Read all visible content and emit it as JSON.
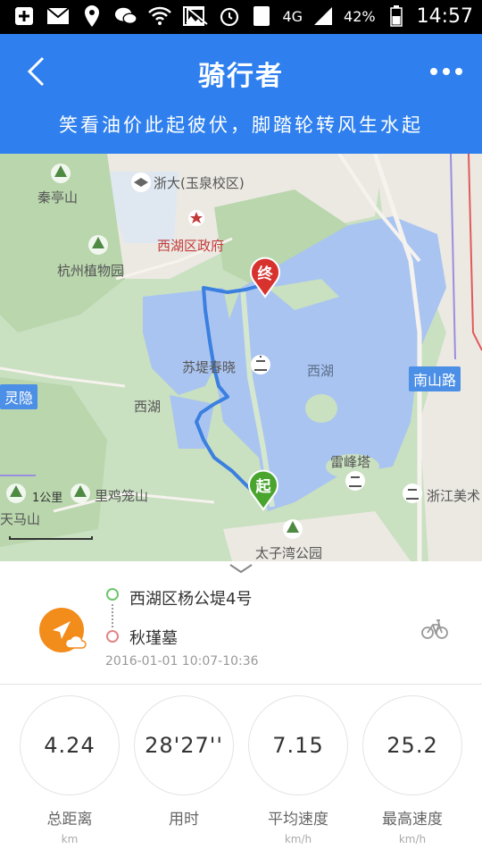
{
  "status_bar": {
    "signal": "4G",
    "sim": "1",
    "battery": "42%",
    "time": "14:57",
    "icons": [
      "add-icon",
      "mail-icon",
      "location-icon",
      "wechat-icon",
      "wifi-icon",
      "image-icon",
      "mute-icon",
      "alarm-icon",
      "sim-icon",
      "signal-icon",
      "battery-icon"
    ]
  },
  "header": {
    "title": "骑行者",
    "slogan": "笑看油价此起彼伏，脚踏轮转风生水起",
    "accent": "#2f80ee"
  },
  "map": {
    "labels": {
      "qinting_shan": "秦亭山",
      "zheda": "浙大(玉泉校区)",
      "district_gov": "西湖区政府",
      "botanical": "杭州植物园",
      "su_causeway": "苏堤春晓",
      "west_lake": "西湖",
      "xihu_small": "西湖",
      "lingyin": "灵隐",
      "leifeng": "雷峰塔",
      "jiliu": "里鸡笼山",
      "tianma": "天马山",
      "zhejiang_museum": "浙江美术",
      "taiziwan": "太子湾公园",
      "nanshan_road": "南山路"
    },
    "markers": {
      "end": "终",
      "start": "起"
    },
    "scale": "1公里",
    "route_color": "#3b7fe0"
  },
  "trip": {
    "start_place": "西湖区杨公堤4号",
    "end_place": "秋瑾墓",
    "time_range": "2016-01-01 10:07-10:36"
  },
  "stats": [
    {
      "value": "4.24",
      "label": "总距离",
      "unit": "km"
    },
    {
      "value": "28'27''",
      "label": "用时",
      "unit": ""
    },
    {
      "value": "7.15",
      "label": "平均速度",
      "unit": "km/h"
    },
    {
      "value": "25.2",
      "label": "最高速度",
      "unit": "km/h"
    }
  ]
}
